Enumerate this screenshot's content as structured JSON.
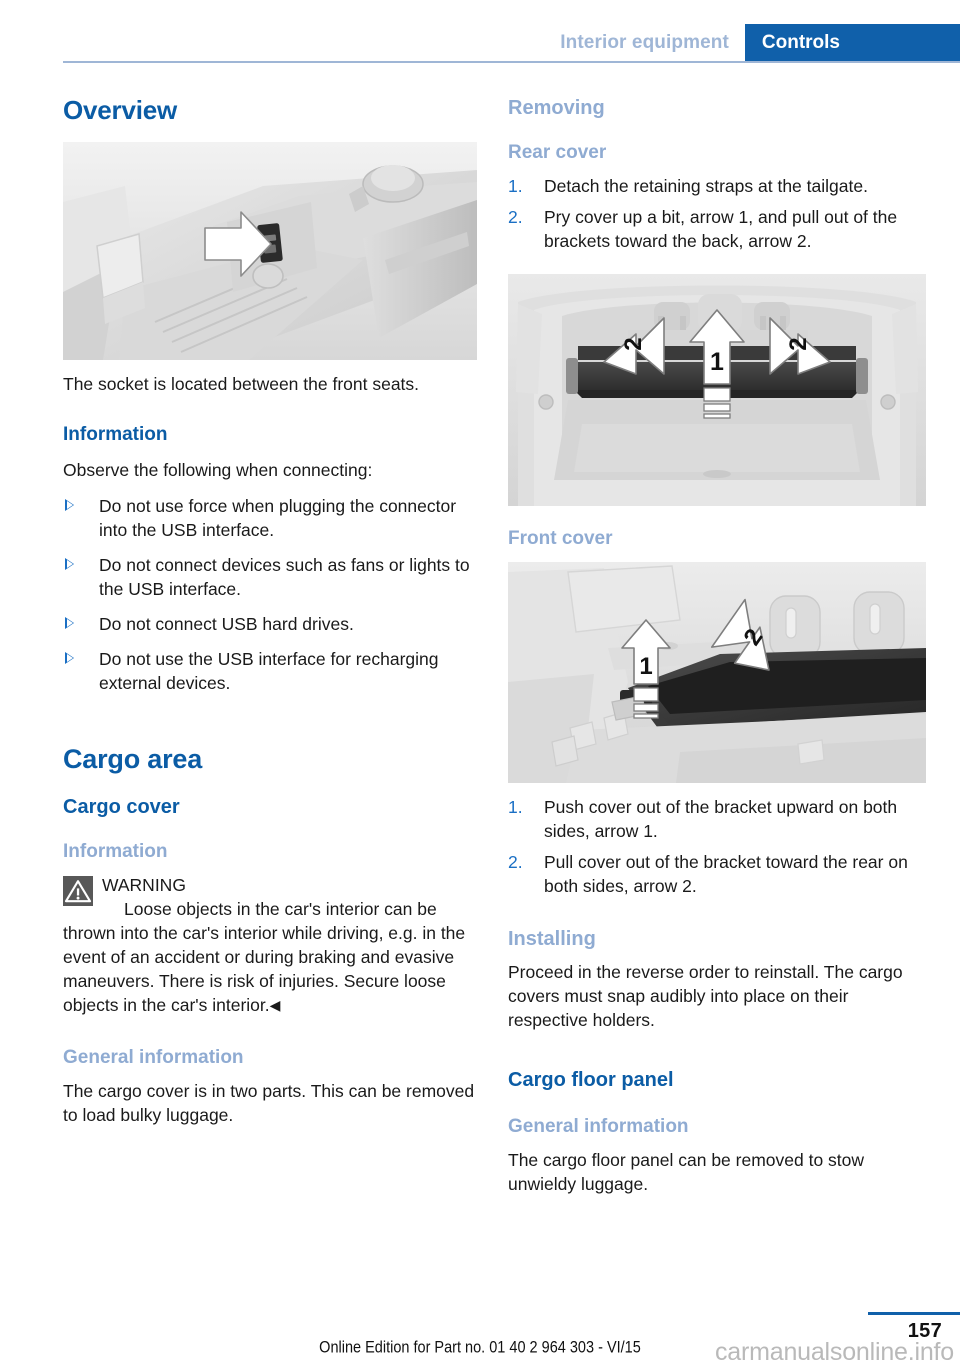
{
  "header": {
    "chapter": "Interior equipment",
    "section": "Controls"
  },
  "left_column": {
    "overview_heading": "Overview",
    "figure_socket_caption": "The socket is located between the front seats.",
    "information_heading": "Information",
    "information_intro": "Observe the following when connecting:",
    "information_bullets": [
      "Do not use force when plugging the connector into the USB interface.",
      "Do not connect devices such as fans or lights to the USB interface.",
      "Do not connect USB hard drives.",
      "Do not use the USB interface for recharging external devices."
    ],
    "cargo_area_heading": "Cargo area",
    "cargo_cover_heading": "Cargo cover",
    "cargo_information_heading": "Information",
    "warning_label": "WARNING",
    "warning_text": "Loose objects in the car's interior can be thrown into the car's interior while driving, e.g. in the event of an accident or during braking and evasive maneuvers. There is risk of injuries. Secure loose objects in the car's interior.",
    "warning_end_mark": "◀",
    "general_information_heading": "General information",
    "general_information_text": "The cargo cover is in two parts. This can be removed to load bulky luggage."
  },
  "right_column": {
    "removing_heading": "Removing",
    "rear_cover_heading": "Rear cover",
    "rear_cover_steps": [
      "Detach the retaining straps at the tailgate.",
      "Pry cover up a bit, arrow 1, and pull out of the brackets toward the back, arrow 2."
    ],
    "front_cover_heading": "Front cover",
    "front_cover_steps": [
      "Push cover out of the bracket upward on both sides, arrow 1.",
      "Pull cover out of the bracket toward the rear on both sides, arrow 2."
    ],
    "installing_heading": "Installing",
    "installing_text": "Proceed in the reverse order to reinstall. The cargo covers must snap audibly into place on their respective holders.",
    "cargo_floor_panel_heading": "Cargo floor panel",
    "floor_general_information_heading": "General information",
    "floor_general_information_text": "The cargo floor panel can be removed to stow unwieldy luggage."
  },
  "figures": {
    "rear_cover_arrow_labels": [
      "2",
      "1",
      "2"
    ],
    "front_cover_arrow_labels": [
      "1",
      "2"
    ]
  },
  "footer": {
    "edition": "Online Edition for Part no. 01 40 2 964 303 - VI/15",
    "page_number": "157",
    "watermark": "carmanualsonline.info"
  },
  "list_numbers": [
    "1.",
    "2."
  ],
  "colors": {
    "accent_blue": "#0b5ca5",
    "header_blue": "#1060aa",
    "light_blue": "#8fabd2",
    "bullet_blue": "#1a6fc4"
  }
}
